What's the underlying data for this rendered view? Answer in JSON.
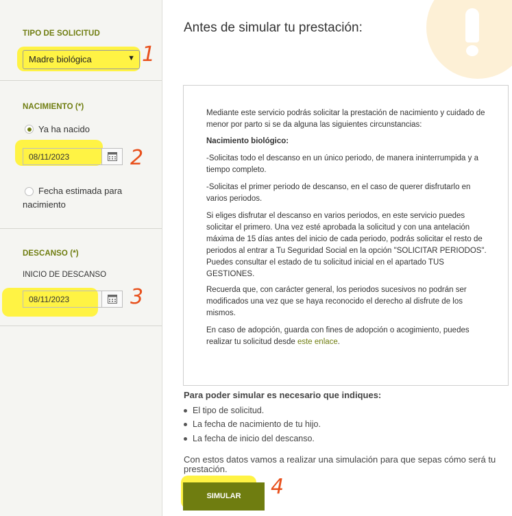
{
  "sidebar": {
    "request_type": {
      "title": "TIPO DE SOLICITUD",
      "selected": "Madre biológica"
    },
    "birth": {
      "title": "NACIMIENTO (*)",
      "option_born": "Ya ha nacido",
      "birth_date": "08/11/2023",
      "option_estimated_line1": "Fecha estimada para",
      "option_estimated_line2": "nacimiento"
    },
    "rest": {
      "title": "DESCANSO (*)",
      "start_label": "INICIO DE DESCANSO",
      "start_date": "08/11/2023"
    }
  },
  "annotations": [
    "1",
    "2",
    "3",
    "4"
  ],
  "main": {
    "title": "Antes de simular tu prestación:",
    "info": {
      "intro": "Mediante este servicio podrás solicitar la prestación de nacimiento y cuidado de menor por parto si se da alguna las siguientes circunstancias:",
      "heading": "Nacimiento biológico:",
      "p1": "-Solicitas todo el descanso en un único periodo, de manera ininterrumpida y a tiempo completo.",
      "p2": "-Solicitas el primer periodo de descanso, en el caso de querer disfrutarlo en varios periodos.",
      "p3": "Si eliges disfrutar el descanso en varios periodos, en este servicio puedes solicitar el primero. Una vez esté aprobada la solicitud y con una antelación máxima de 15 días antes del inicio de cada periodo, podrás solicitar el resto de periodos al entrar a Tu Seguridad Social en la opción \"SOLICITAR PERIODOS\". Puedes consultar el estado de tu solicitud inicial en el apartado TUS GESTIONES.",
      "p4": "Recuerda que, con carácter general, los periodos sucesivos no podrán ser modificados una vez que se haya reconocido el derecho al disfrute de los mismos.",
      "p5": "En caso de adopción, guarda con fines de adopción o acogimiento, puedes realizar tu solicitud desde",
      "p5_link": "este enlace",
      "p5_end": "."
    },
    "requirements_title": "Para poder simular es necesario que indiques:",
    "requirements": [
      "El tipo de solicitud.",
      "La fecha de nacimiento de tu hijo.",
      "La fecha de inicio del descanso."
    ],
    "closing": "Con estos datos vamos a realizar una simulación para que sepas cómo será tu prestación.",
    "simulate_button": "SIMULAR"
  },
  "colors": {
    "accent": "#6f7d10",
    "highlight": "#fff23a",
    "annotation": "#e8501c",
    "warning_bg": "#fdf0d6"
  }
}
